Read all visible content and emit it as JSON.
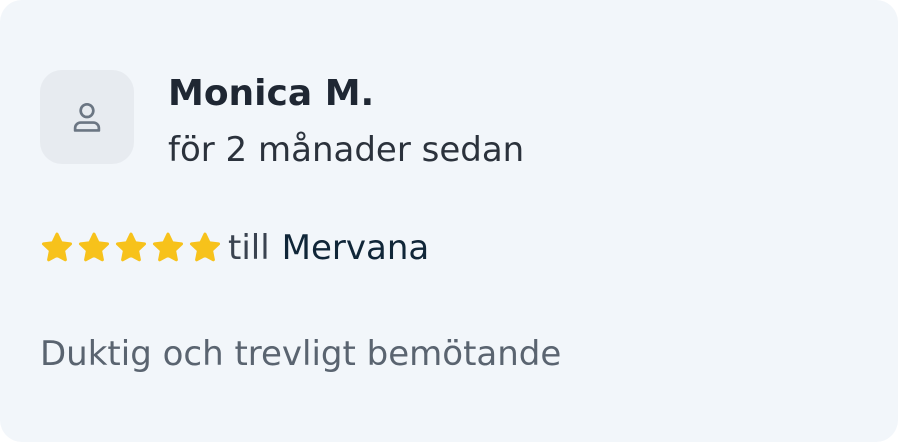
{
  "review": {
    "author": "Monica M.",
    "time_ago": "för 2 månader sedan",
    "rating": 5,
    "rating_max": 5,
    "till_label": "till",
    "provider": "Mervana",
    "text": "Duktig och trevligt bemötande",
    "avatar_icon": "user-icon",
    "star_icon": "star-icon",
    "star_color": "#f7c21b"
  }
}
